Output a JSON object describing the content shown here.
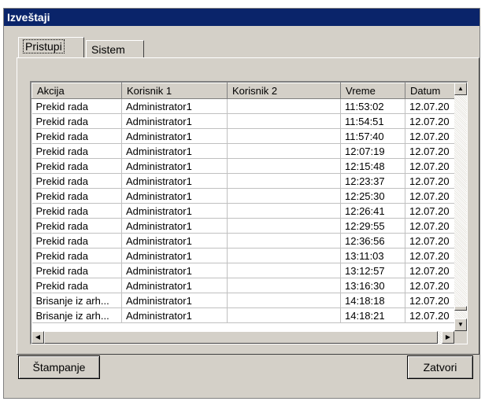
{
  "window": {
    "title": "Izveštaji"
  },
  "tabs": [
    {
      "label": "Pristupi",
      "active": true
    },
    {
      "label": "Sistem",
      "active": false
    }
  ],
  "table": {
    "columns": [
      "Akcija",
      "Korisnik 1",
      "Korisnik 2",
      "Vreme",
      "Datum"
    ],
    "rows": [
      [
        "Prekid rada",
        "Administrator1",
        "",
        "11:53:02",
        "12.07.20"
      ],
      [
        "Prekid rada",
        "Administrator1",
        "",
        "11:54:51",
        "12.07.20"
      ],
      [
        "Prekid rada",
        "Administrator1",
        "",
        "11:57:40",
        "12.07.20"
      ],
      [
        "Prekid rada",
        "Administrator1",
        "",
        "12:07:19",
        "12.07.20"
      ],
      [
        "Prekid rada",
        "Administrator1",
        "",
        "12:15:48",
        "12.07.20"
      ],
      [
        "Prekid rada",
        "Administrator1",
        "",
        "12:23:37",
        "12.07.20"
      ],
      [
        "Prekid rada",
        "Administrator1",
        "",
        "12:25:30",
        "12.07.20"
      ],
      [
        "Prekid rada",
        "Administrator1",
        "",
        "12:26:41",
        "12.07.20"
      ],
      [
        "Prekid rada",
        "Administrator1",
        "",
        "12:29:55",
        "12.07.20"
      ],
      [
        "Prekid rada",
        "Administrator1",
        "",
        "12:36:56",
        "12.07.20"
      ],
      [
        "Prekid rada",
        "Administrator1",
        "",
        "13:11:03",
        "12.07.20"
      ],
      [
        "Prekid rada",
        "Administrator1",
        "",
        "13:12:57",
        "12.07.20"
      ],
      [
        "Prekid rada",
        "Administrator1",
        "",
        "13:16:30",
        "12.07.20"
      ],
      [
        "Brisanje iz arh...",
        "Administrator1",
        "",
        "14:18:18",
        "12.07.20"
      ],
      [
        "Brisanje iz arh...",
        "Administrator1",
        "",
        "14:18:21",
        "12.07.20"
      ]
    ]
  },
  "buttons": {
    "print": "Štampanje",
    "close": "Zatvori"
  },
  "icons": {
    "scroll_up": "arrow-up-icon",
    "scroll_down": "arrow-down-icon",
    "scroll_left": "arrow-left-icon",
    "scroll_right": "arrow-right-icon"
  }
}
